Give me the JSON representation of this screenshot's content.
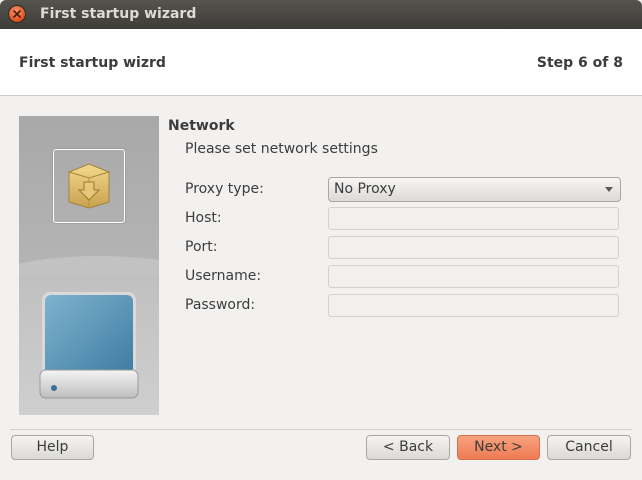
{
  "window": {
    "title": "First startup wizard"
  },
  "header": {
    "title": "First startup wizrd",
    "step": "Step 6 of 8"
  },
  "section": {
    "title": "Network",
    "subtitle": "Please set network settings"
  },
  "form": {
    "proxy_type": {
      "label": "Proxy type:",
      "value": "No Proxy"
    },
    "host": {
      "label": "Host:",
      "value": ""
    },
    "port": {
      "label": "Port:",
      "value": ""
    },
    "username": {
      "label": "Username:",
      "value": ""
    },
    "password": {
      "label": "Password:",
      "value": ""
    }
  },
  "footer": {
    "help": "Help",
    "back": "< Back",
    "next": "Next >",
    "cancel": "Cancel"
  },
  "colors": {
    "titlebar": "#3d3c38",
    "accent_button": "#ee7b53",
    "close_button": "#e0501d"
  },
  "icons": {
    "close": "close-icon",
    "package": "package-icon",
    "drive": "hard-drive-icon",
    "dropdown": "chevron-down-icon"
  }
}
